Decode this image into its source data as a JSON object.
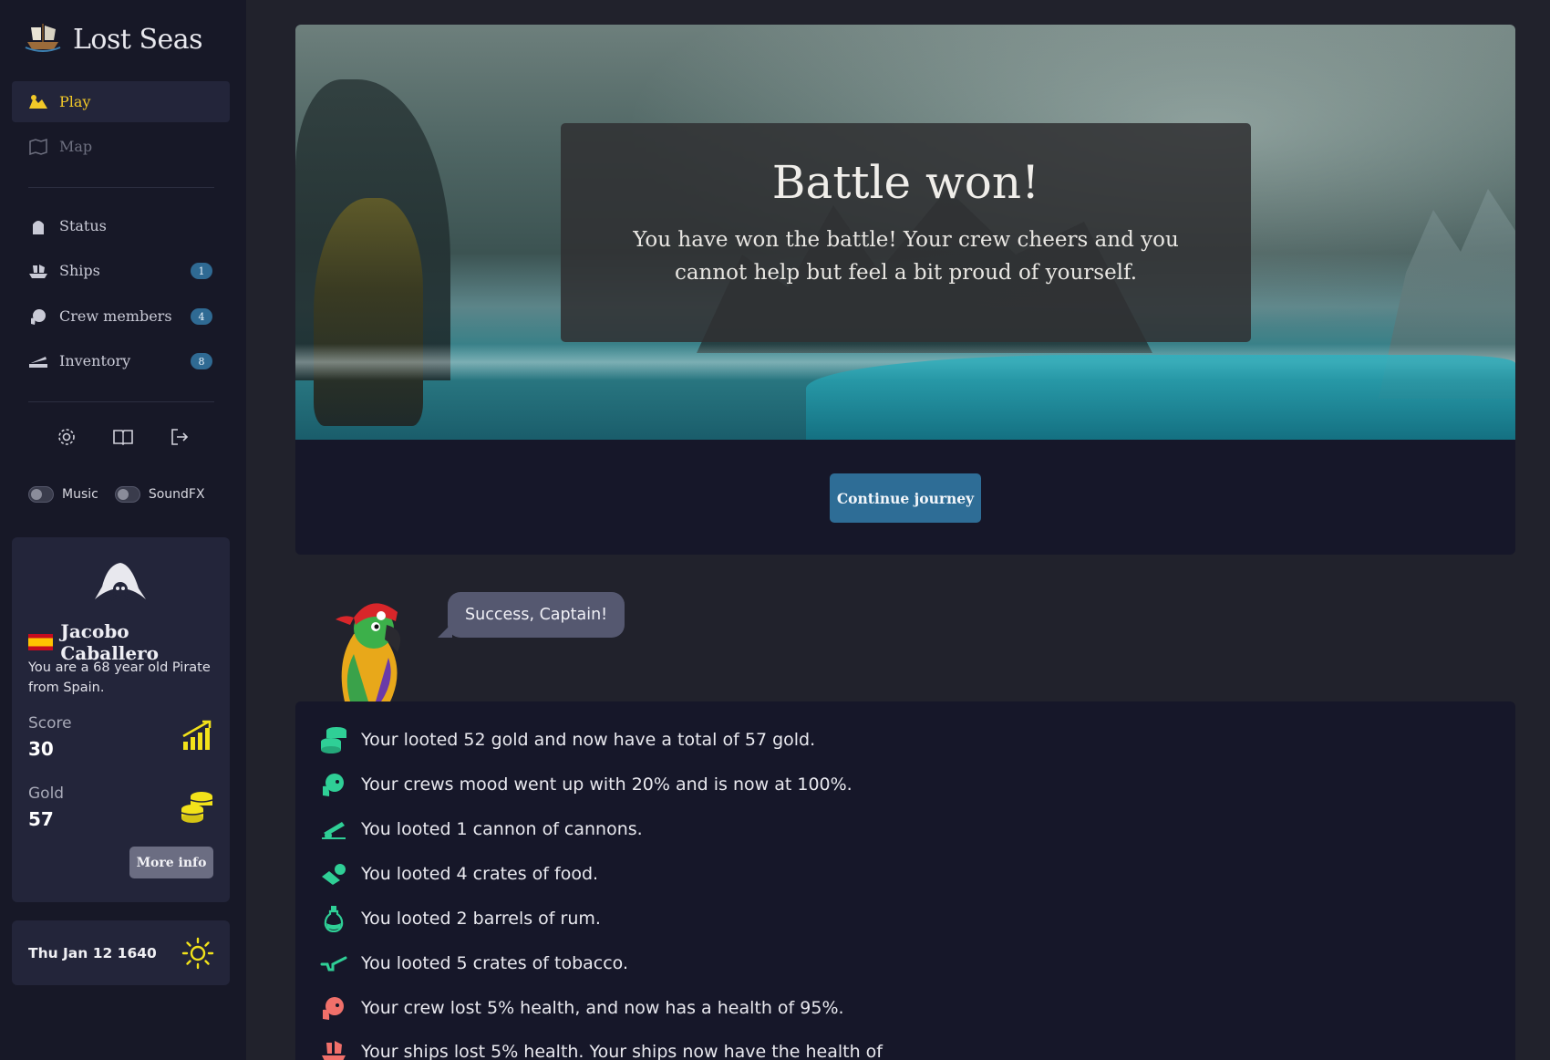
{
  "app": {
    "title": "Lost Seas"
  },
  "sidebar": {
    "nav_primary": [
      {
        "label": "Play",
        "icon": "play-icon",
        "active": true
      },
      {
        "label": "Map",
        "icon": "map-icon",
        "active": false
      }
    ],
    "nav_secondary": [
      {
        "label": "Status",
        "icon": "status-icon",
        "badge": ""
      },
      {
        "label": "Ships",
        "icon": "ship-icon",
        "badge": "1"
      },
      {
        "label": "Crew members",
        "icon": "crew-icon",
        "badge": "4"
      },
      {
        "label": "Inventory",
        "icon": "inventory-icon",
        "badge": "8"
      }
    ],
    "tools": [
      "gear-icon",
      "book-icon",
      "logout-icon"
    ],
    "toggles": {
      "music_label": "Music",
      "soundfx_label": "SoundFX"
    },
    "profile": {
      "name": "Jacobo Caballero",
      "flag": "spain-flag-icon",
      "description": "You are a 68 year old Pirate from Spain.",
      "score_label": "Score",
      "score_value": "30",
      "gold_label": "Gold",
      "gold_value": "57",
      "more_info_label": "More info"
    },
    "date": {
      "text": "Thu Jan 12 1640",
      "weather_icon": "sun-icon"
    }
  },
  "main": {
    "overlay": {
      "title": "Battle won!",
      "text": "You have won the battle! Your crew cheers and you cannot help but feel a bit proud of yourself."
    },
    "continue_label": "Continue journey",
    "parrot_message": "Success, Captain!",
    "log": [
      {
        "icon": "coins-icon",
        "text": "Your looted 52 gold and now have a total of 57 gold."
      },
      {
        "icon": "crew-icon",
        "text": "Your crews mood went up with 20% and is now at 100%."
      },
      {
        "icon": "cannon-icon",
        "text": "You looted 1 cannon of cannons."
      },
      {
        "icon": "food-icon",
        "text": "You looted 4 crates of food."
      },
      {
        "icon": "rum-icon",
        "text": "You looted 2 barrels of rum."
      },
      {
        "icon": "pipe-icon",
        "text": "You looted 5 crates of tobacco."
      },
      {
        "icon": "crew-health-icon",
        "text": "Your crew lost 5% health, and now has a health of 95%."
      },
      {
        "icon": "ship-health-icon",
        "text": "Your ships lost 5% health. Your ships now have the health of"
      }
    ]
  },
  "colors": {
    "accent_yellow": "#f2c928",
    "badge_blue": "#2f6a93",
    "button_blue": "#2e6d96",
    "log_icon_green": "#2fcf96",
    "log_icon_red": "#f0706a"
  }
}
